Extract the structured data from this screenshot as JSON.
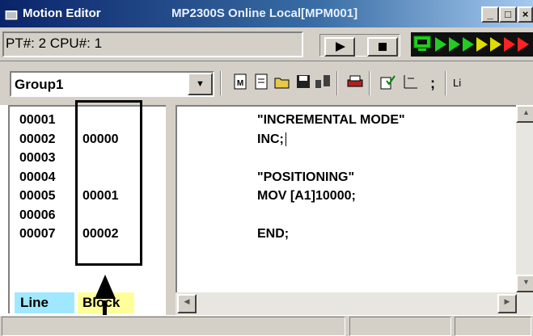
{
  "window": {
    "app_title": "Motion Editor",
    "status_title": "MP2300S  Online  Local[MPM001]",
    "minimize_label": "_",
    "maximize_label": "□",
    "close_label": "×"
  },
  "status_bar_top": {
    "pt_cpu": "PT#: 2 CPU#: 1"
  },
  "toolbar": {
    "group_value": "Group1",
    "partial_label": "Li",
    "icons": [
      "m-doc-icon",
      "doc-icon",
      "open-folder-icon",
      "save-icon",
      "network-icon",
      "print-icon",
      "check-icon",
      "axis-icon",
      "semicolon-icon"
    ]
  },
  "line_numbers": [
    "00001",
    "00002",
    "00003",
    "00004",
    "00005",
    "00006",
    "00007"
  ],
  "block_numbers": [
    "",
    "00000",
    "",
    "",
    "00001",
    "",
    "00002"
  ],
  "code_lines": [
    "\"INCREMENTAL MODE\"",
    "INC;",
    "",
    "\"POSITIONING\"",
    "MOV [A1]10000;",
    "",
    "END;"
  ],
  "legend": {
    "line_label": "Line",
    "block_label": "Block",
    "line_color": "#a0e8ff",
    "block_color": "#ffff99"
  },
  "colors": {
    "titlebar": "#0a246a",
    "face": "#d4d0c8",
    "status_lights": [
      "#22cc22",
      "#22cc22",
      "#22cc22",
      "#dddd00",
      "#dddd00",
      "#ff2222",
      "#ff2222"
    ]
  }
}
